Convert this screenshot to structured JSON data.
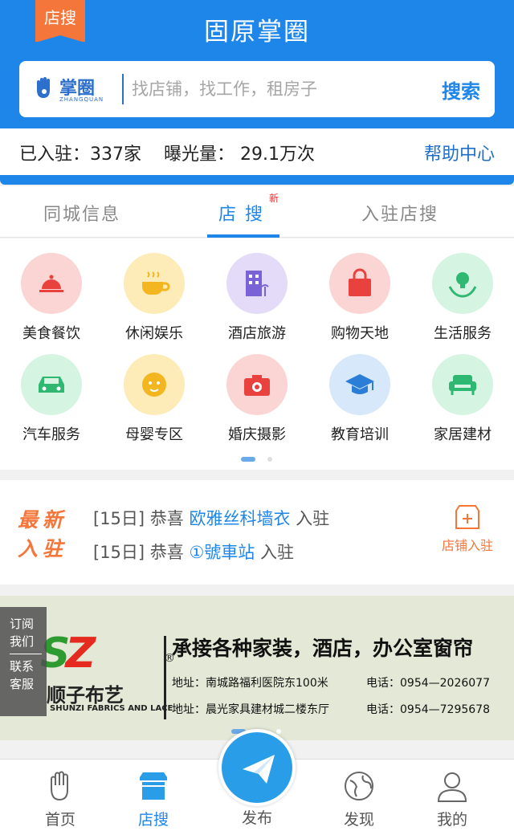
{
  "header": {
    "badge": "店搜",
    "title": "固原掌圈",
    "logo_text": "掌圈",
    "logo_sub": "ZHANGQUAN",
    "search_placeholder": "找店铺，找工作，租房子",
    "search_button": "搜索"
  },
  "stats": {
    "joined": "已入驻：337家",
    "exposure": "曝光量：  29.1万次",
    "help": "帮助中心"
  },
  "tabs": [
    {
      "label": "同城信息"
    },
    {
      "label": "店  搜",
      "badge": "新"
    },
    {
      "label": "入驻店搜"
    }
  ],
  "categories": [
    {
      "label": "美食餐饮",
      "icon": "food-cloche-icon",
      "color": "#fbd4d4"
    },
    {
      "label": "休闲娱乐",
      "icon": "coffee-cup-icon",
      "color": "#fdebb8"
    },
    {
      "label": "酒店旅游",
      "icon": "hotel-icon",
      "color": "#e3dbf8"
    },
    {
      "label": "购物天地",
      "icon": "shopping-bag-icon",
      "color": "#fbd4d4"
    },
    {
      "label": "生活服务",
      "icon": "lightbulb-hands-icon",
      "color": "#d6f4e2"
    },
    {
      "label": "汽车服务",
      "icon": "car-icon",
      "color": "#d6f4e2"
    },
    {
      "label": "母婴专区",
      "icon": "baby-icon",
      "color": "#fdebb8"
    },
    {
      "label": "婚庆摄影",
      "icon": "camera-heart-icon",
      "color": "#fbd4d4"
    },
    {
      "label": "教育培训",
      "icon": "graduation-cap-icon",
      "color": "#d7e8fb"
    },
    {
      "label": "家居建材",
      "icon": "sofa-icon",
      "color": "#d6f4e2"
    }
  ],
  "new_entries": {
    "label_line1": "最新",
    "label_line2": "入驻",
    "items": [
      {
        "date": "[15日]",
        "prefix": "恭喜",
        "name": "欧雅丝科墙衣",
        "suffix": "入驻"
      },
      {
        "date": "[15日]",
        "prefix": "恭喜",
        "name": "①號車站",
        "suffix": "入驻"
      }
    ],
    "shop_join": "店铺入驻"
  },
  "banner": {
    "logo": "SZ",
    "reg": "®",
    "brand_cn": "顺子布艺",
    "brand_en": "SHUNZI FABRICS AND LACE",
    "title": "承接各种家装，酒店，办公室窗帘",
    "addr1": "地址：南城路福利医院东100米",
    "tel1": "电话：0954—2026077",
    "addr2": "地址：晨光家具建材城二楼东厅",
    "tel2": "电话：0954—7295678"
  },
  "side_float": {
    "line1": "订阅",
    "line2": "我们",
    "line3": "联系",
    "line4": "客服"
  },
  "tabbar": [
    {
      "label": "首页",
      "icon": "hand-icon"
    },
    {
      "label": "店搜",
      "icon": "shop-icon",
      "active": true
    },
    {
      "label": "发布",
      "icon": "paper-plane-icon"
    },
    {
      "label": "发现",
      "icon": "globe-icon"
    },
    {
      "label": "我的",
      "icon": "user-icon"
    }
  ],
  "colors": {
    "primary": "#1f86e9",
    "accent": "#f4763a"
  }
}
